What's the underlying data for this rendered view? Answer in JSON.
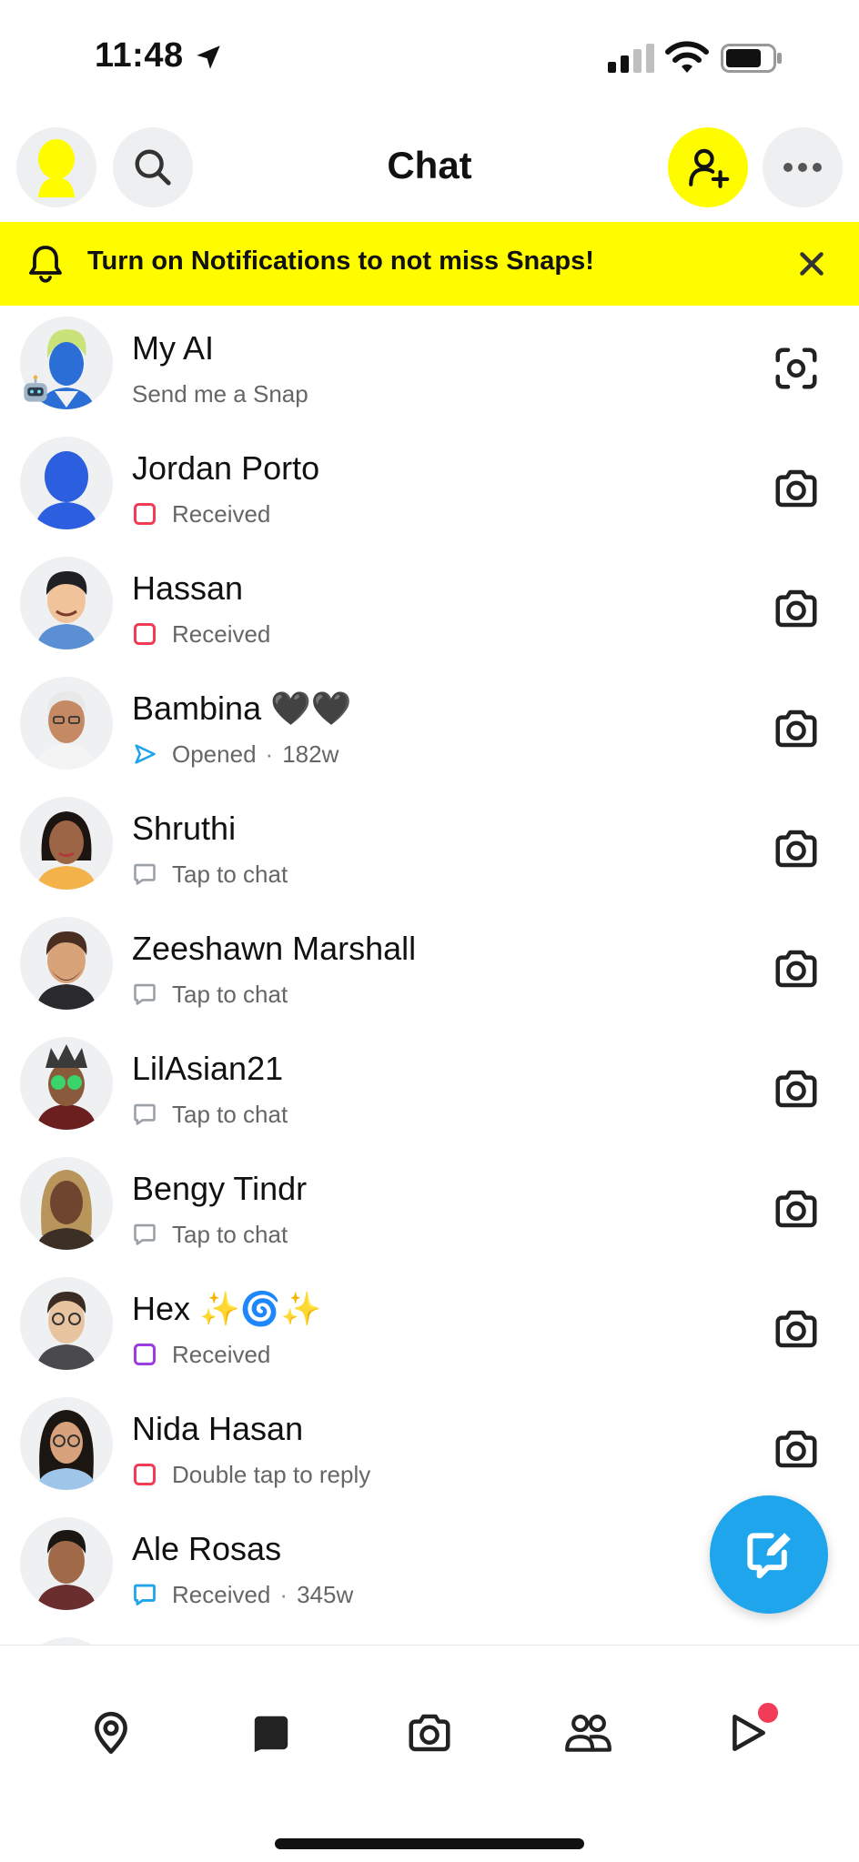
{
  "status_bar": {
    "time": "11:48"
  },
  "header": {
    "title": "Chat"
  },
  "banner": {
    "text": "Turn on Notifications to not miss Snaps!"
  },
  "colors": {
    "snap_yellow": "#fffc00",
    "received_red": "#f23c57",
    "received_purple": "#9b3de0",
    "chat_blue": "#1fa5ec",
    "chat_gray": "#9aa0a6"
  },
  "chats": [
    {
      "name": "My AI",
      "status": "Send me a Snap",
      "age": "",
      "status_type": "none",
      "action_icon": "scan-icon"
    },
    {
      "name": "Jordan Porto",
      "status": "Received",
      "age": "",
      "status_type": "received-snap",
      "action_icon": "camera-icon"
    },
    {
      "name": "Hassan",
      "status": "Received",
      "age": "",
      "status_type": "received-snap",
      "action_icon": "camera-icon"
    },
    {
      "name": "Bambina 🖤🖤",
      "status": "Opened",
      "age": "182w",
      "status_type": "opened-chat",
      "action_icon": "camera-icon"
    },
    {
      "name": "Shruthi",
      "status": "Tap to chat",
      "age": "",
      "status_type": "tap-to-chat",
      "action_icon": "camera-icon"
    },
    {
      "name": "Zeeshawn Marshall",
      "status": "Tap to chat",
      "age": "",
      "status_type": "tap-to-chat",
      "action_icon": "camera-icon"
    },
    {
      "name": "LilAsian21",
      "status": "Tap to chat",
      "age": "",
      "status_type": "tap-to-chat",
      "action_icon": "camera-icon"
    },
    {
      "name": "Bengy Tindr",
      "status": "Tap to chat",
      "age": "",
      "status_type": "tap-to-chat",
      "action_icon": "camera-icon"
    },
    {
      "name": "Hex ✨🌀✨",
      "status": "Received",
      "age": "",
      "status_type": "received-video",
      "action_icon": "camera-icon"
    },
    {
      "name": "Nida Hasan",
      "status": "Double tap to reply",
      "age": "",
      "status_type": "received-snap",
      "action_icon": "camera-icon"
    },
    {
      "name": "Ale Rosas",
      "status": "Received",
      "age": "345w",
      "status_type": "received-chat",
      "action_icon": "camera-icon"
    }
  ],
  "bottom_nav": {
    "items": [
      "map-icon",
      "chat-icon",
      "camera-icon",
      "friends-icon",
      "stories-icon"
    ],
    "active": "chat-icon"
  }
}
